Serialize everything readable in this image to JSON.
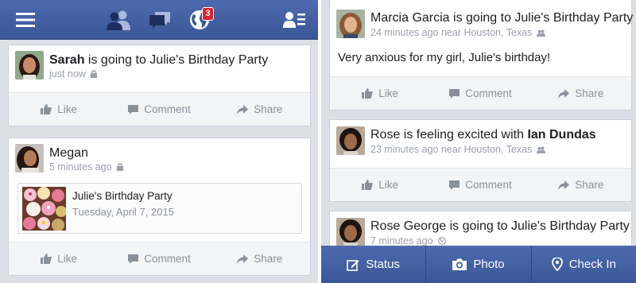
{
  "top_bar": {
    "icons": [
      "menu-icon",
      "friends-icon",
      "messages-icon",
      "notifications-globe-icon",
      "contacts-icon"
    ],
    "notification_count": "3",
    "accent_color": "#3b5998",
    "badge_color": "#e0232d"
  },
  "actions": {
    "like": "Like",
    "comment": "Comment",
    "share": "Share"
  },
  "left_feed": [
    {
      "author": "Sarah",
      "text": " is going to Julie's Birthday Party",
      "meta": "just now",
      "privacy_icon": "lock-icon"
    },
    {
      "author": "Megan",
      "meta": "5 minutes ago",
      "privacy_icon": "lock-icon",
      "event": {
        "title": "Julie's Birthday Party",
        "date": "Tuesday, April 7, 2015",
        "image": "cupcakes-image"
      }
    }
  ],
  "right_feed": [
    {
      "author": "Marcia Garcia",
      "text": " is going to Julie's Birthday Party",
      "meta": "24 minutes ago near Houston, Texas",
      "privacy_icon": "friends-small-icon",
      "body": "Very anxious for my girl, Julie's birthday!"
    },
    {
      "author": "Rose",
      "text": " is feeling excited with ",
      "tagged": "Ian Dundas",
      "meta": "23 minutes ago near Houston, Texas",
      "privacy_icon": "friends-small-icon"
    },
    {
      "author": "Rose George",
      "text": " is going to Julie's Birthday Party",
      "meta": "7 minutes ago",
      "privacy_icon": "globe-small-icon"
    }
  ],
  "bottom_bar": {
    "status": "Status",
    "photo": "Photo",
    "check_in": "Check In"
  }
}
